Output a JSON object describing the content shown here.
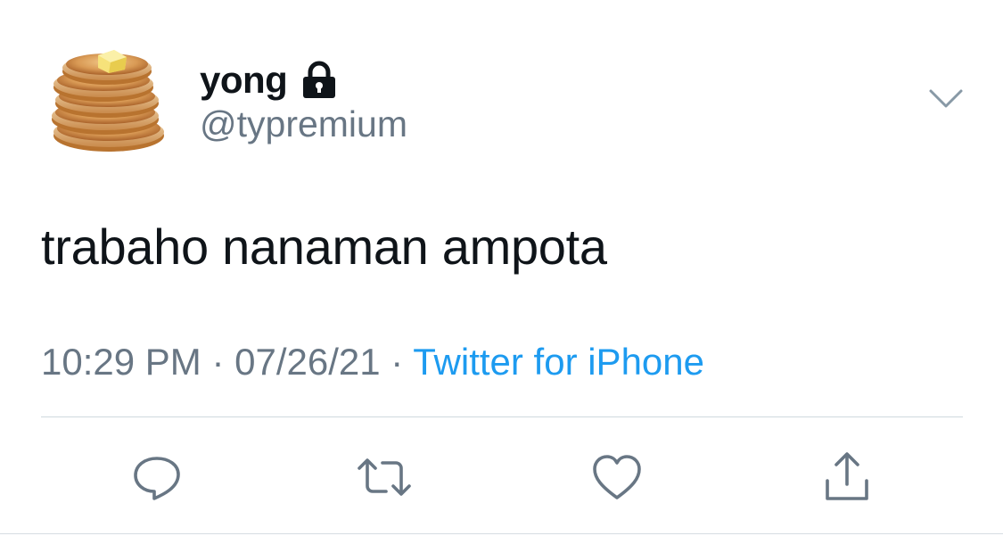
{
  "user": {
    "display_name": "yong",
    "handle": "@typremium",
    "avatar_icon": "pancake-stack-avatar",
    "protected_icon": "lock-icon"
  },
  "tweet": {
    "text": "trabaho nanaman ampota",
    "time": "10:29 PM",
    "separator": " · ",
    "date": "07/26/21",
    "source": "Twitter for iPhone"
  },
  "actions": [
    {
      "icon": "reply-icon"
    },
    {
      "icon": "retweet-icon"
    },
    {
      "icon": "like-icon"
    },
    {
      "icon": "share-icon"
    }
  ],
  "colors": {
    "primary_text": "#0f1419",
    "secondary_text": "#687684",
    "link": "#1d9bf0",
    "divider": "#cfd9de"
  }
}
